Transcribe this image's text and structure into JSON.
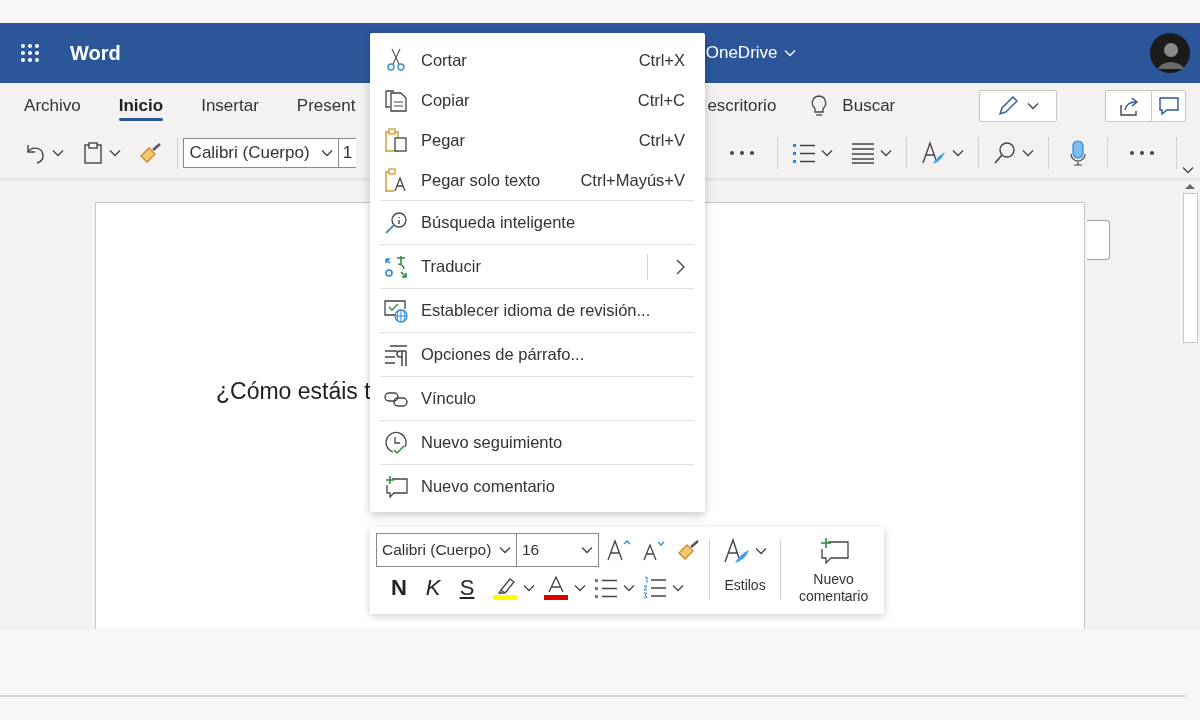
{
  "header": {
    "app_name": "Word",
    "location": "OneDrive"
  },
  "ribbon_tabs": [
    {
      "label": "Archivo",
      "selected": false
    },
    {
      "label": "Inicio",
      "selected": true
    },
    {
      "label": "Insertar",
      "selected": false
    },
    {
      "label": "Present",
      "selected": false
    }
  ],
  "ribbon_link": "escritorio",
  "search": {
    "label": "Buscar"
  },
  "toolbar": {
    "font": "Calibri (Cuerpo)",
    "size": "1"
  },
  "document": {
    "text": "¿Cómo estáis t"
  },
  "context_menu": {
    "groups": [
      [
        {
          "label": "Cortar",
          "shortcut": "Ctrl+X"
        },
        {
          "label": "Copiar",
          "shortcut": "Ctrl+C"
        },
        {
          "label": "Pegar",
          "shortcut": "Ctrl+V"
        },
        {
          "label": "Pegar solo texto",
          "shortcut": "Ctrl+Mayús+V"
        }
      ],
      [
        {
          "label": "Búsqueda inteligente"
        }
      ],
      [
        {
          "label": "Traducir",
          "submenu": true
        }
      ],
      [
        {
          "label": "Establecer idioma de revisión..."
        }
      ],
      [
        {
          "label": "Opciones de párrafo..."
        }
      ],
      [
        {
          "label": "Vínculo"
        }
      ],
      [
        {
          "label": "Nuevo seguimiento"
        }
      ],
      [
        {
          "label": "Nuevo comentario"
        }
      ]
    ]
  },
  "mini_toolbar": {
    "font": "Calibri (Cuerpo)",
    "size": "16",
    "bold": "N",
    "italic": "K",
    "underline": "S",
    "styles_label": "Estilos",
    "comment_label": "Nuevo comentario"
  }
}
